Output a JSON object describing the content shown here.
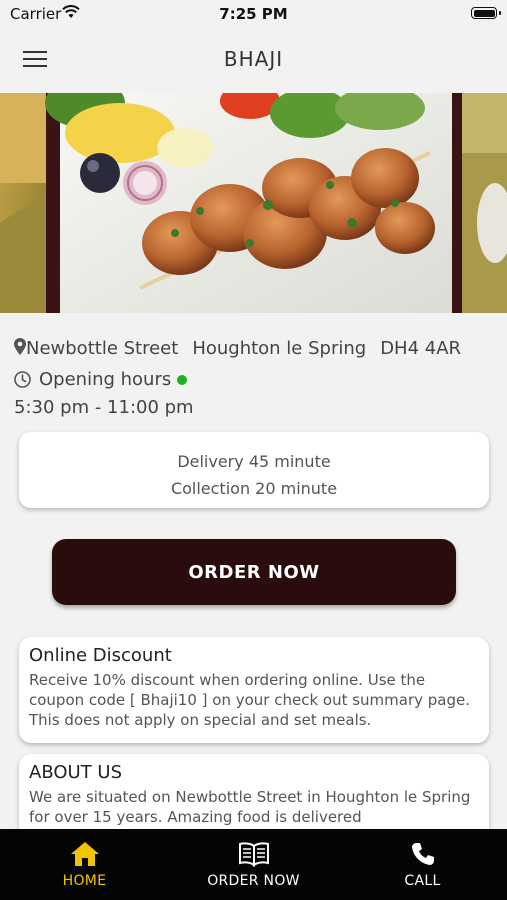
{
  "status": {
    "carrier": "Carrier",
    "time": "7:25 PM"
  },
  "header": {
    "title": "BHAJI"
  },
  "location": {
    "street": "Newbottle Street",
    "town": "Houghton le Spring",
    "postcode": "DH4 4AR",
    "hours_label": "Opening hours",
    "hours": "5:30 pm - 11:00 pm",
    "open_status_color": "#20b020"
  },
  "times": {
    "delivery": "Delivery 45 minute",
    "collection": "Collection 20 minute"
  },
  "order_button": {
    "label": "ORDER NOW"
  },
  "discount": {
    "title": "Online Discount",
    "body": "Receive 10% discount when ordering online. Use the coupon code [ Bhaji10 ] on your check out summary page. This does not apply on special and set meals."
  },
  "about": {
    "title": "ABOUT US",
    "body": "We are situated on Newbottle Street in Houghton le Spring for over 15 years. Amazing food is delivered"
  },
  "tabs": [
    {
      "label": "HOME",
      "icon": "home-icon",
      "active": true
    },
    {
      "label": "ORDER NOW",
      "icon": "menu-book-icon",
      "active": false
    },
    {
      "label": "CALL",
      "icon": "phone-icon",
      "active": false
    }
  ],
  "colors": {
    "accent": "#f2c400",
    "order_button": "#2b0c0c",
    "tab_bar": "#050505"
  }
}
